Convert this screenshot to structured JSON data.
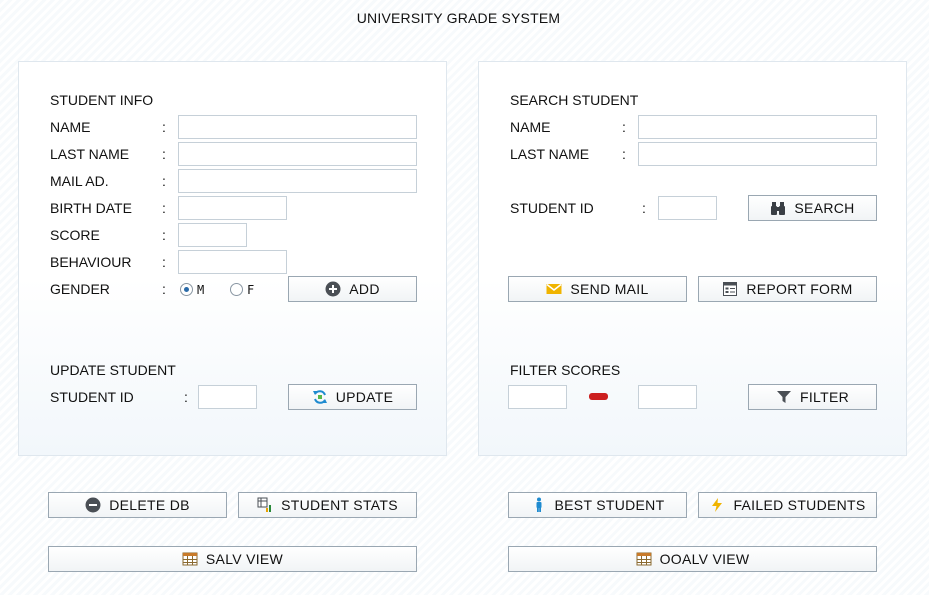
{
  "title": "UNIVERSITY GRADE SYSTEM",
  "student_info": {
    "heading": "STUDENT INFO",
    "colon": ":",
    "fields": {
      "name": {
        "label": "NAME",
        "value": ""
      },
      "last_name": {
        "label": "LAST NAME",
        "value": ""
      },
      "mail": {
        "label": "MAIL AD.",
        "value": ""
      },
      "birth_date": {
        "label": "BIRTH DATE",
        "value": ""
      },
      "score": {
        "label": "SCORE",
        "value": ""
      },
      "behaviour": {
        "label": "BEHAVIOUR",
        "value": ""
      }
    },
    "gender": {
      "label": "GENDER",
      "options": [
        "M",
        "F"
      ],
      "selected": "M"
    },
    "add_label": "ADD"
  },
  "update_student": {
    "heading": "UPDATE STUDENT",
    "id_label": "STUDENT ID",
    "id_value": "",
    "update_label": "UPDATE"
  },
  "search_student": {
    "heading": "SEARCH STUDENT",
    "name_label": "NAME",
    "last_name_label": "LAST NAME",
    "id_label": "STUDENT ID",
    "search_label": "SEARCH",
    "send_mail_label": "SEND MAIL",
    "report_form_label": "REPORT FORM"
  },
  "filter_scores": {
    "heading": "FILTER SCORES",
    "min_value": "",
    "max_value": "",
    "filter_label": "FILTER"
  },
  "bottom": {
    "delete_db_label": "DELETE DB",
    "student_stats_label": "STUDENT STATS",
    "best_student_label": "BEST STUDENT",
    "failed_students_label": "FAILED STUDENTS",
    "salv_view_label": "SALV VIEW",
    "ooalv_view_label": "OOALV VIEW"
  },
  "colors": {
    "accent_blue": "#2a6aa8",
    "mail_yellow": "#f0b400",
    "range_red": "#cc1f1f",
    "person_blue": "#1e8bd0"
  }
}
